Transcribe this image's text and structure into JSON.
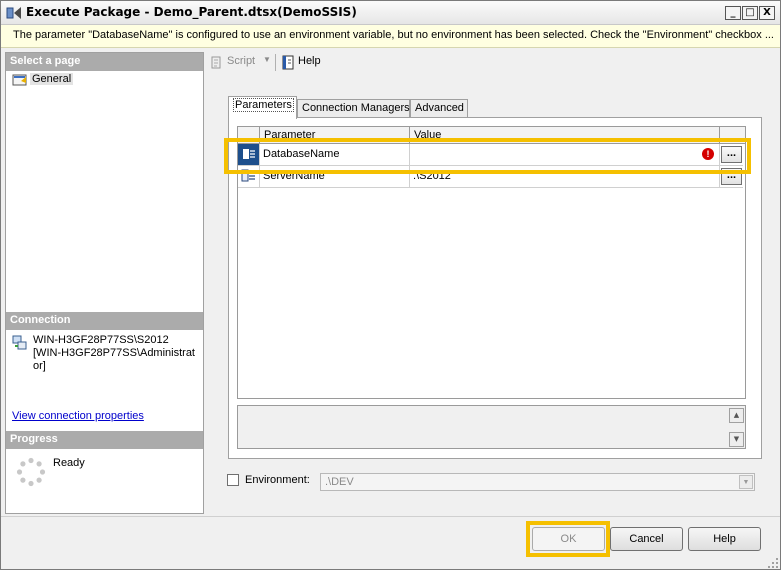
{
  "window": {
    "title": "Execute Package - Demo_Parent.dtsx(DemoSSIS)",
    "min_glyph": "_",
    "max_glyph": "□",
    "close_glyph": "X"
  },
  "infobar": {
    "message": "The parameter \"DatabaseName\" is configured to use an environment variable, but no environment has been selected.  Check the \"Environment\" checkbox ..."
  },
  "left_panel": {
    "select_page_header": "Select a page",
    "pages": [
      {
        "label": "General"
      }
    ],
    "connection_header": "Connection",
    "connection_server": "WIN-H3GF28P77SS\\S2012",
    "connection_user": "[WIN-H3GF28P77SS\\Administrator]",
    "view_connection_link": "View connection properties",
    "progress_header": "Progress",
    "progress_status": "Ready"
  },
  "toolbar": {
    "script_label": "Script",
    "help_label": "Help"
  },
  "tabs": [
    {
      "label": "Parameters",
      "active": true
    },
    {
      "label": "Connection Managers",
      "active": false
    },
    {
      "label": "Advanced",
      "active": false
    }
  ],
  "grid": {
    "columns": [
      "Parameter",
      "Value"
    ],
    "rows": [
      {
        "parameter": "DatabaseName",
        "value": "",
        "error": true,
        "button": "..."
      },
      {
        "parameter": "ServerName",
        "value": ".\\S2012",
        "error": false,
        "button": "..."
      }
    ],
    "error_glyph": "!"
  },
  "environment": {
    "label": "Environment:",
    "checked": false,
    "selected": ".\\DEV"
  },
  "buttons": {
    "ok": "OK",
    "cancel": "Cancel",
    "help": "Help"
  },
  "colors": {
    "highlight": "#f5c000",
    "infobar_bg": "#ffffe1",
    "section_header_bg": "#ababab",
    "error_red": "#d40000",
    "link": "#0000cc"
  }
}
